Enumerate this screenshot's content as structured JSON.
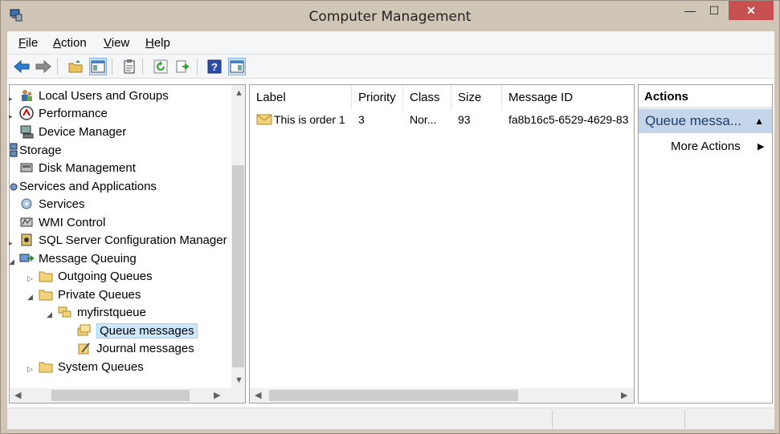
{
  "window": {
    "title": "Computer Management",
    "controls": {
      "minimize": "—",
      "maximize": "☐",
      "close": "✕"
    }
  },
  "menu": [
    {
      "accel": "F",
      "rest": "ile"
    },
    {
      "accel": "A",
      "rest": "ction"
    },
    {
      "accel": "V",
      "rest": "iew"
    },
    {
      "accel": "H",
      "rest": "elp"
    }
  ],
  "toolbar": {
    "icons": [
      "back-arrow-icon",
      "forward-arrow-icon",
      "up-folder-icon",
      "show-hide-tree-icon",
      "properties-icon",
      "refresh-icon",
      "export-list-icon",
      "help-icon",
      "show-hide-action-pane-icon"
    ]
  },
  "tree": {
    "items": [
      {
        "label": "Local Users and Groups",
        "icon": "users-icon"
      },
      {
        "label": "Performance",
        "icon": "performance-icon"
      },
      {
        "label": "Device Manager",
        "icon": "device-manager-icon"
      },
      {
        "label": "Storage",
        "icon": "storage-icon"
      },
      {
        "label": "Disk Management",
        "icon": "disk-icon"
      },
      {
        "label": "Services and Applications",
        "icon": "services-apps-icon"
      },
      {
        "label": "Services",
        "icon": "gear-icon"
      },
      {
        "label": "WMI Control",
        "icon": "wmi-icon"
      },
      {
        "label": "SQL Server Configuration Manager",
        "icon": "sql-icon"
      },
      {
        "label": "Message Queuing",
        "icon": "message-queuing-icon"
      },
      {
        "label": "Outgoing Queues",
        "icon": "folder-icon"
      },
      {
        "label": "Private Queues",
        "icon": "folder-icon"
      },
      {
        "label": "myfirstqueue",
        "icon": "queue-icon"
      },
      {
        "label": "Queue messages",
        "icon": "queue-messages-icon"
      },
      {
        "label": "Journal messages",
        "icon": "journal-icon"
      },
      {
        "label": "System Queues",
        "icon": "folder-icon"
      }
    ],
    "selected": "Queue messages"
  },
  "list": {
    "columns": [
      "Label",
      "Priority",
      "Class",
      "Size",
      "Message ID"
    ],
    "rows": [
      [
        "This is order 1",
        "3",
        "Nor...",
        "93",
        "fa8b16c5-6529-4629-83"
      ]
    ]
  },
  "actions": {
    "header": "Actions",
    "section": "Queue messa...",
    "more": "More Actions"
  },
  "colors": {
    "titlebar": "#d0c6b7",
    "close_button": "#c75050",
    "selection": "#cce8ff",
    "action_section": "#c5d6ea"
  }
}
